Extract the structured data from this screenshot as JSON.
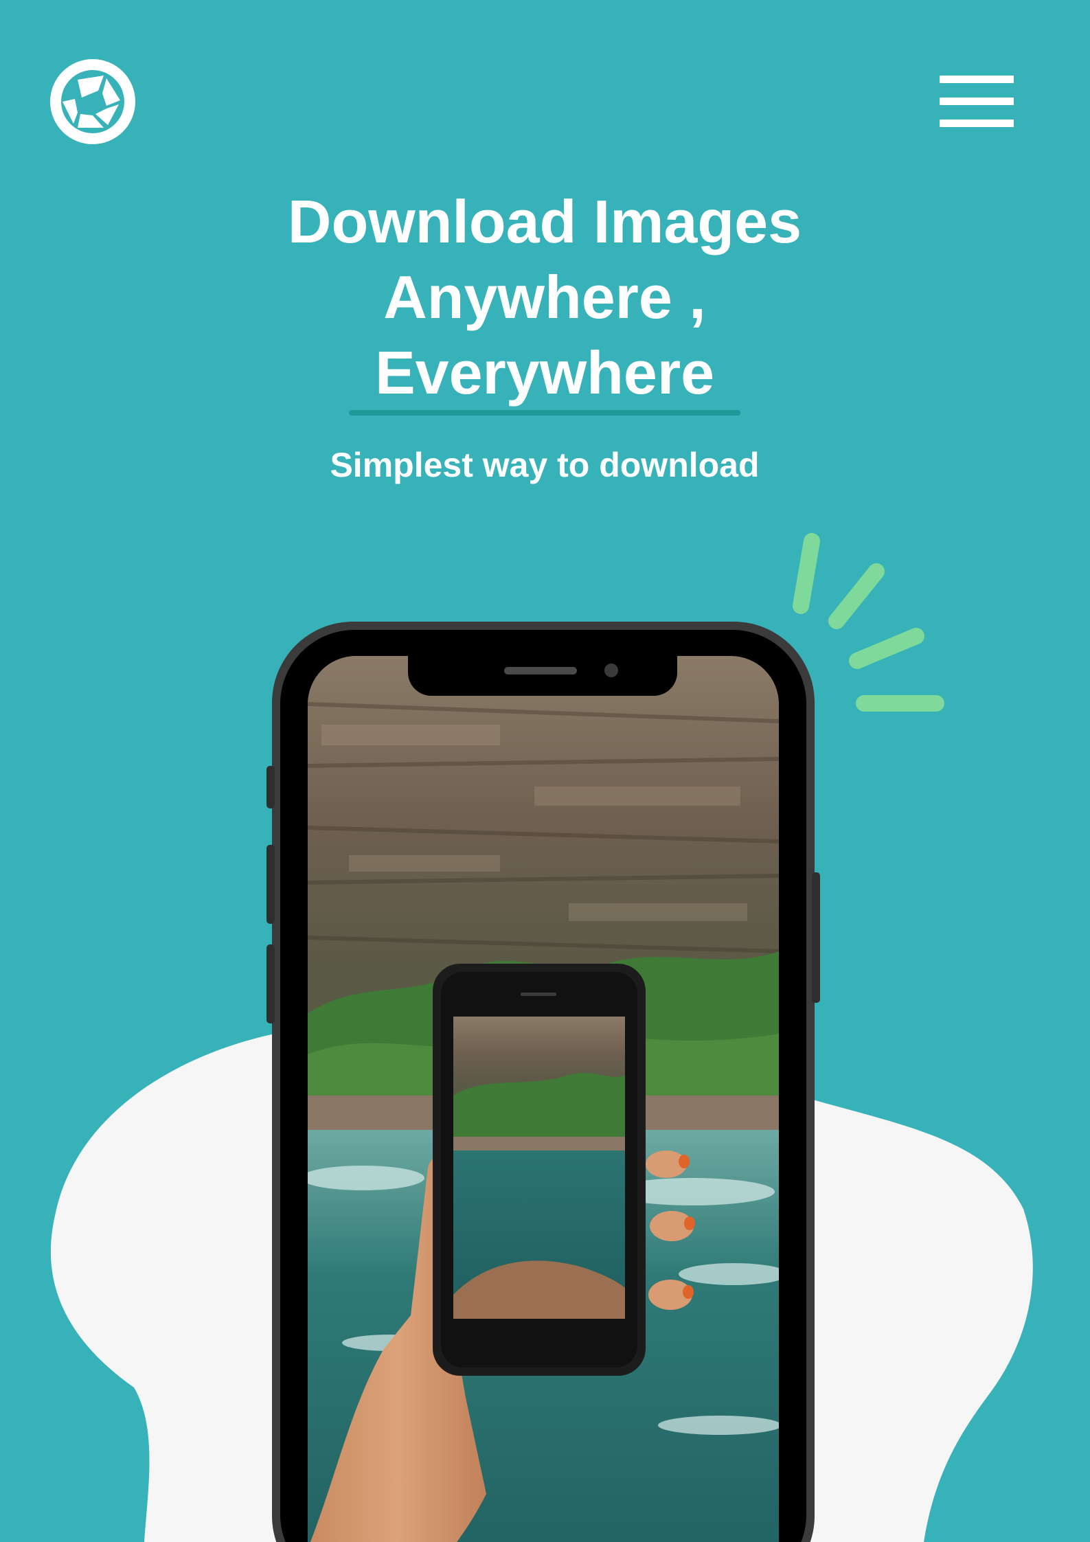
{
  "colors": {
    "background": "#38b2b9",
    "blob": "#f6f6f6",
    "accent_underline": "#1f989a",
    "sparkle": "#7ed99a",
    "text": "#ffffff",
    "phone_frame": "#3b3b3b"
  },
  "header": {
    "logo_icon": "shutter-logo-icon",
    "menu_icon": "hamburger-menu-icon"
  },
  "hero": {
    "title_lines": [
      "Download Images",
      "Anywhere ,",
      "Everywhere"
    ],
    "subtitle": "Simplest way to download"
  },
  "illustration": {
    "device": "smartphone",
    "photo_subject": "hand holding a phone photographing a river canyon"
  }
}
